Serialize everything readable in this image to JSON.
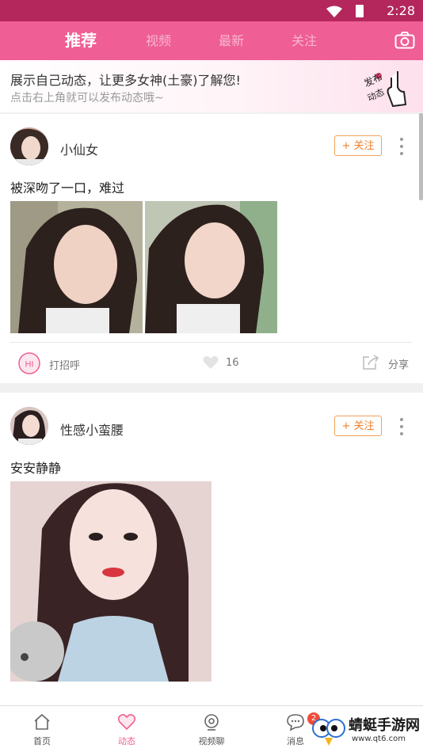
{
  "status_bar": {
    "time": "2:28"
  },
  "top_tabs": [
    "推荐",
    "视频",
    "最新",
    "关注"
  ],
  "banner": {
    "line1": "展示自己动态，让更多女神(土豪)了解您!",
    "line2": "点击右上角就可以发布动态哦~",
    "badge_text": "发布动态"
  },
  "posts": [
    {
      "username": "小仙女",
      "follow_label": "关注",
      "text": "被深吻了一口，难过",
      "greet_icon": "HI",
      "greet_label": "打招呼",
      "likes": "16",
      "share_label": "分享"
    },
    {
      "username": "性感小蛮腰",
      "follow_label": "关注",
      "text": "安安静静"
    }
  ],
  "bottom_nav": [
    {
      "label": "首页",
      "icon": "home-icon"
    },
    {
      "label": "动态",
      "icon": "heart-icon"
    },
    {
      "label": "视频聊",
      "icon": "video-chat-icon"
    },
    {
      "label": "消息",
      "icon": "message-icon",
      "badge": "2"
    }
  ],
  "watermark": {
    "title": "蜻蜓手游网",
    "url": "www.qt6.com"
  },
  "colors": {
    "accent": "#ef5e95",
    "status_bar": "#b3275c",
    "follow": "#f07f2a"
  }
}
